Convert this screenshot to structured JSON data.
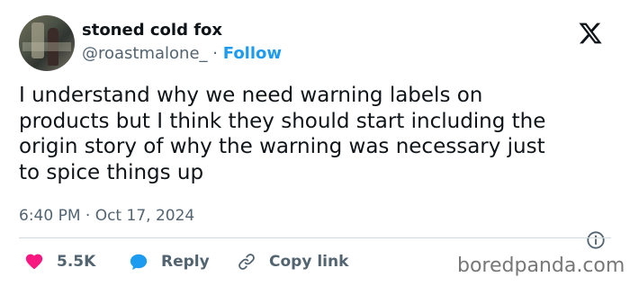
{
  "author": {
    "display_name": "stoned cold fox",
    "handle": "@roastmalone_",
    "separator": "·",
    "follow_label": "Follow"
  },
  "tweet": {
    "lines": [
      "I understand why we need warning labels on",
      "products but I think they should start including the",
      "origin story of why the warning was necessary just",
      "to spice things up"
    ],
    "timestamp": "6:40 PM · Oct 17, 2024"
  },
  "actions": {
    "like_count": "5.5K",
    "reply_label": "Reply",
    "copy_link_label": "Copy link"
  },
  "watermark": "boredpanda.com",
  "colors": {
    "accent": "#1d9bf0",
    "like": "#f91880",
    "text": "#0f1419",
    "secondary": "#536471"
  },
  "icons": {
    "platform": "x-logo-icon",
    "info": "info-icon",
    "like": "heart-icon",
    "reply": "speech-bubble-icon",
    "copy": "link-icon"
  }
}
